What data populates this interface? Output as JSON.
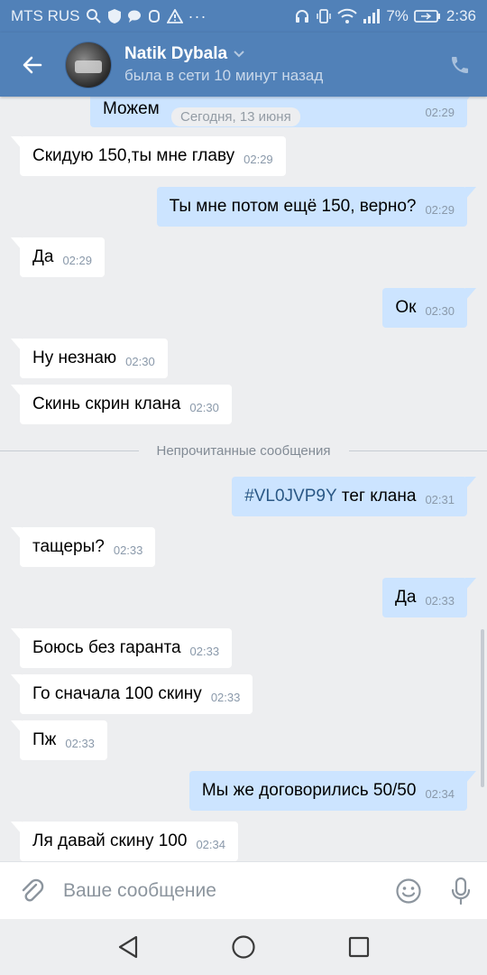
{
  "status_bar": {
    "carrier": "MTS RUS",
    "battery": "7%",
    "time": "2:36"
  },
  "header": {
    "name": "Natik Dybala",
    "status": "была в сети 10 минут назад"
  },
  "date_label": "Сегодня, 13 июня",
  "unread_label": "Непрочитанные сообщения",
  "messages": [
    {
      "dir": "out",
      "text": "Можем",
      "time": "02:29"
    },
    {
      "dir": "in",
      "text": "Скидую 150,ты мне главу",
      "time": "02:29"
    },
    {
      "dir": "out",
      "text": "Ты мне потом ещё 150, верно?",
      "time": "02:29"
    },
    {
      "dir": "in",
      "text": "Да",
      "time": "02:29"
    },
    {
      "dir": "out",
      "text": "Ок",
      "time": "02:30"
    },
    {
      "dir": "in",
      "text": "Ну незнаю",
      "time": "02:30"
    },
    {
      "dir": "in",
      "text": "Скинь скрин клана",
      "time": "02:30"
    },
    {
      "dir": "out",
      "hashtag": "#VL0JVP9Y",
      "text": " тег клана",
      "time": "02:31"
    },
    {
      "dir": "in",
      "text": "тащеры?",
      "time": "02:33"
    },
    {
      "dir": "out",
      "text": "Да",
      "time": "02:33"
    },
    {
      "dir": "in",
      "text": "Боюсь без гаранта",
      "time": "02:33"
    },
    {
      "dir": "in",
      "text": "Го сначала 100 скину",
      "time": "02:33"
    },
    {
      "dir": "in",
      "text": "Пж",
      "time": "02:33"
    },
    {
      "dir": "out",
      "text": "Мы же договорились 50/50",
      "time": "02:34"
    },
    {
      "dir": "in",
      "text": "Ля давай скину 100",
      "time": "02:34"
    }
  ],
  "composer": {
    "placeholder": "Ваше сообщение"
  },
  "colors": {
    "header": "#5181b8",
    "outgoing_bubble": "#cce4ff",
    "incoming_bubble": "#ffffff",
    "background": "#edeef0",
    "hashtag": "#2a5885"
  }
}
